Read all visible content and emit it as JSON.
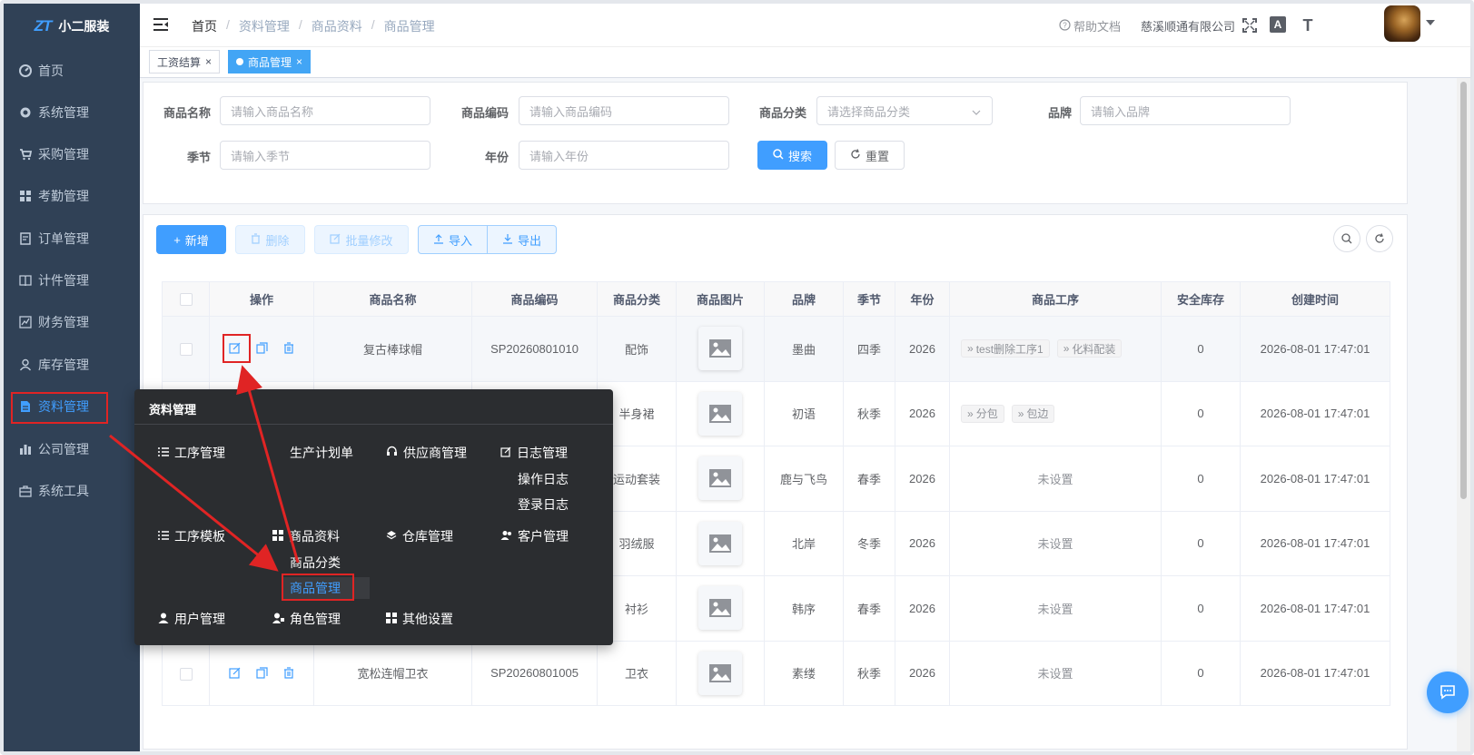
{
  "app": {
    "logo_mark": "ZT",
    "name": "小二服装"
  },
  "sidebar": {
    "items": [
      {
        "label": "首页",
        "icon": "dashboard-icon"
      },
      {
        "label": "系统管理",
        "icon": "gear-icon"
      },
      {
        "label": "采购管理",
        "icon": "cart-icon"
      },
      {
        "label": "考勤管理",
        "icon": "grid-icon"
      },
      {
        "label": "订单管理",
        "icon": "order-icon"
      },
      {
        "label": "计件管理",
        "icon": "book-icon"
      },
      {
        "label": "财务管理",
        "icon": "chart-icon"
      },
      {
        "label": "库存管理",
        "icon": "user-icon"
      },
      {
        "label": "资料管理",
        "icon": "document-icon",
        "active": true
      },
      {
        "label": "公司管理",
        "icon": "bar-icon"
      },
      {
        "label": "系统工具",
        "icon": "toolbox-icon"
      }
    ]
  },
  "header": {
    "breadcrumb": [
      "首页",
      "资料管理",
      "商品资料",
      "商品管理"
    ],
    "help": "帮助文档",
    "company": "慈溪顺通有限公司",
    "font_icon_text": "A",
    "size_icon_text": "T"
  },
  "tags": [
    {
      "label": "工资结算",
      "active": false
    },
    {
      "label": "商品管理",
      "active": true
    }
  ],
  "search": {
    "fields": [
      {
        "label": "商品名称",
        "placeholder": "请输入商品名称"
      },
      {
        "label": "商品编码",
        "placeholder": "请输入商品编码"
      },
      {
        "label": "商品分类",
        "placeholder": "请选择商品分类"
      },
      {
        "label": "品牌",
        "placeholder": "请输入品牌"
      },
      {
        "label": "季节",
        "placeholder": "请输入季节"
      },
      {
        "label": "年份",
        "placeholder": "请输入年份"
      }
    ],
    "search_btn": "搜索",
    "reset_btn": "重置"
  },
  "toolbar": {
    "add": "新增",
    "delete": "删除",
    "batch_edit": "批量修改",
    "import": "导入",
    "export": "导出"
  },
  "table": {
    "columns": [
      "操作",
      "商品名称",
      "商品编码",
      "商品分类",
      "商品图片",
      "品牌",
      "季节",
      "年份",
      "商品工序",
      "安全库存",
      "创建时间"
    ],
    "rows": [
      {
        "name": "复古棒球帽",
        "code": "SP20260801010",
        "category": "配饰",
        "brand": "墨曲",
        "season": "四季",
        "year": "2026",
        "processes": [
          "test删除工序1",
          "化料配装"
        ],
        "unset": "",
        "stock": "0",
        "created": "2026-08-01 17:47:01"
      },
      {
        "name": "",
        "code": "",
        "category": "半身裙",
        "brand": "初语",
        "season": "秋季",
        "year": "2026",
        "processes": [
          "分包",
          "包边"
        ],
        "unset": "",
        "stock": "0",
        "created": "2026-08-01 17:47:01"
      },
      {
        "name": "",
        "code": "",
        "category": "运动套装",
        "brand": "鹿与飞鸟",
        "season": "春季",
        "year": "2026",
        "processes": [],
        "unset": "未设置",
        "stock": "0",
        "created": "2026-08-01 17:47:01"
      },
      {
        "name": "",
        "code": "",
        "category": "羽绒服",
        "brand": "北岸",
        "season": "冬季",
        "year": "2026",
        "processes": [],
        "unset": "未设置",
        "stock": "0",
        "created": "2026-08-01 17:47:01"
      },
      {
        "name": "",
        "code": "",
        "category": "衬衫",
        "brand": "韩序",
        "season": "春季",
        "year": "2026",
        "processes": [],
        "unset": "未设置",
        "stock": "0",
        "created": "2026-08-01 17:47:01"
      },
      {
        "name": "宽松连帽卫衣",
        "code": "SP20260801005",
        "category": "卫衣",
        "brand": "素缕",
        "season": "秋季",
        "year": "2026",
        "processes": [],
        "unset": "未设置",
        "stock": "0",
        "created": "2026-08-01 17:47:01"
      }
    ]
  },
  "flyout": {
    "title": "资料管理",
    "items": {
      "process_mgmt": "工序管理",
      "production_plan": "生产计划单",
      "supplier_mgmt": "供应商管理",
      "log_mgmt": "日志管理",
      "op_log": "操作日志",
      "login_log": "登录日志",
      "process_template": "工序模板",
      "product_info": "商品资料",
      "warehouse_mgmt": "仓库管理",
      "customer_mgmt": "客户管理",
      "product_category": "商品分类",
      "product_mgmt": "商品管理",
      "user_mgmt": "用户管理",
      "role_mgmt": "角色管理",
      "other_settings": "其他设置"
    }
  },
  "colors": {
    "sidebar_bg": "#304156",
    "primary": "#409eff",
    "annotation": "#e02424",
    "flyout_bg": "#2b2d30"
  }
}
